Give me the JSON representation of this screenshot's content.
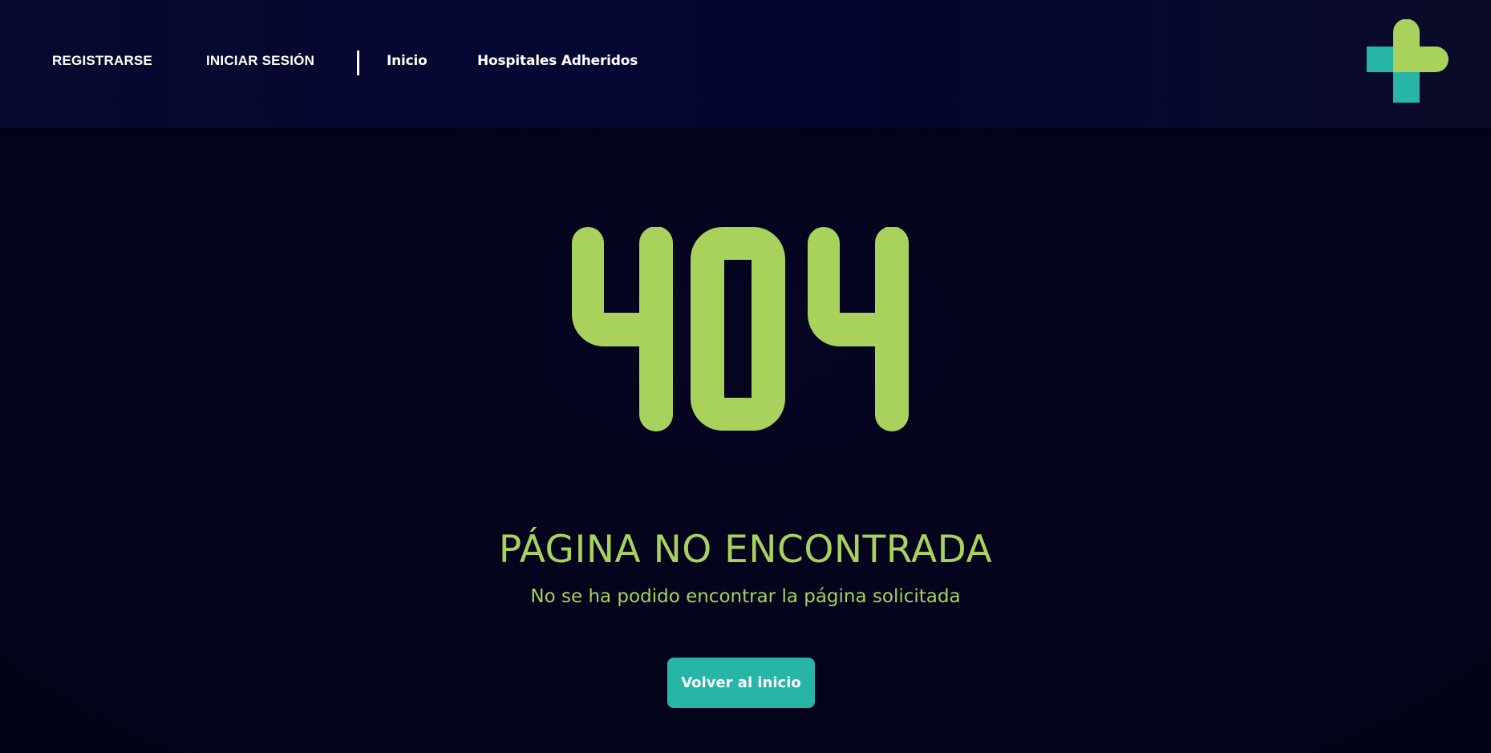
{
  "nav": {
    "register": "REGISTRARSE",
    "login": "INICIAR SESIÓN",
    "home": "Inicio",
    "hospitals": "Hospitales Adheridos"
  },
  "logo": {
    "icon": "medical-cross-icon",
    "colors": {
      "teal": "#26b5a7",
      "green": "#a8d25c"
    }
  },
  "error": {
    "code": "404",
    "title": "PÁGINA NO ENCONTRADA",
    "message": "No se ha podido encontrar la página solicitada",
    "button_label": "Volver al inicio"
  },
  "colors": {
    "background": "#04041a",
    "navbar": "#050733",
    "accent_green": "#a8d25c",
    "accent_teal": "#26b5a7",
    "nav_text": "#ffffff"
  }
}
